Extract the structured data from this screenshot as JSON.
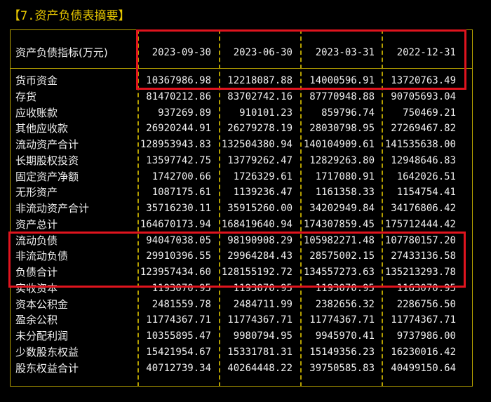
{
  "title": "【7.资产负债表摘要】",
  "header": {
    "label": "资产负债指标(万元)",
    "dates": [
      "2023-09-30",
      "2023-06-30",
      "2023-03-31",
      "2022-12-31"
    ]
  },
  "rows": [
    {
      "label": "货币资金",
      "values": [
        "10367986.98",
        "12218087.88",
        "14000596.91",
        "13720763.49"
      ]
    },
    {
      "label": "存货",
      "values": [
        "81470212.86",
        "83702742.16",
        "87770948.88",
        "90705693.04"
      ]
    },
    {
      "label": "应收账款",
      "values": [
        "937269.89",
        "910101.23",
        "859796.74",
        "750469.21"
      ]
    },
    {
      "label": "其他应收款",
      "values": [
        "26920244.91",
        "26279278.19",
        "28030798.95",
        "27269467.82"
      ]
    },
    {
      "label": "流动资产合计",
      "values": [
        "128953943.83",
        "132504380.94",
        "140104909.61",
        "141535638.00"
      ]
    },
    {
      "label": "长期股权投资",
      "values": [
        "13597742.75",
        "13779262.47",
        "12829263.80",
        "12948646.83"
      ]
    },
    {
      "label": "固定资产净额",
      "values": [
        "1742700.66",
        "1726329.61",
        "1717080.91",
        "1642026.51"
      ]
    },
    {
      "label": "无形资产",
      "values": [
        "1087175.61",
        "1139236.47",
        "1161358.33",
        "1154754.41"
      ]
    },
    {
      "label": "非流动资产合计",
      "values": [
        "35716230.11",
        "35915260.00",
        "34202949.84",
        "34176806.42"
      ]
    },
    {
      "label": "资产总计",
      "values": [
        "164670173.94",
        "168419640.94",
        "174307859.45",
        "175712444.42"
      ]
    },
    {
      "label": "流动负债",
      "values": [
        "94047038.05",
        "98190908.29",
        "105982271.48",
        "107780157.20"
      ]
    },
    {
      "label": "非流动负债",
      "values": [
        "29910396.55",
        "29964284.43",
        "28575002.15",
        "27433136.58"
      ]
    },
    {
      "label": "负债合计",
      "values": [
        "123957434.60",
        "128155192.72",
        "134557273.63",
        "135213293.78"
      ]
    },
    {
      "label": "实收资本",
      "values": [
        "1193070.95",
        "1193070.95",
        "1193070.95",
        "1163070.95"
      ]
    },
    {
      "label": "资本公积金",
      "values": [
        "2481559.78",
        "2484711.99",
        "2382656.32",
        "2286756.50"
      ]
    },
    {
      "label": "盈余公积",
      "values": [
        "11774367.71",
        "11774367.71",
        "11774367.71",
        "11774367.71"
      ]
    },
    {
      "label": "未分配利润",
      "values": [
        "10355895.47",
        "9980794.95",
        "9945970.41",
        "9737986.00"
      ]
    },
    {
      "label": "少数股东权益",
      "values": [
        "15421954.67",
        "15331781.31",
        "15149356.23",
        "16230016.42"
      ]
    },
    {
      "label": "股东权益合计",
      "values": [
        "40712739.34",
        "40264448.22",
        "39750585.83",
        "40499150.64"
      ]
    }
  ],
  "colors": {
    "background": "#000000",
    "title": "#e8c800",
    "grid": "#b5a000",
    "text": "#f0f0f0",
    "highlight": "#e0141e"
  }
}
